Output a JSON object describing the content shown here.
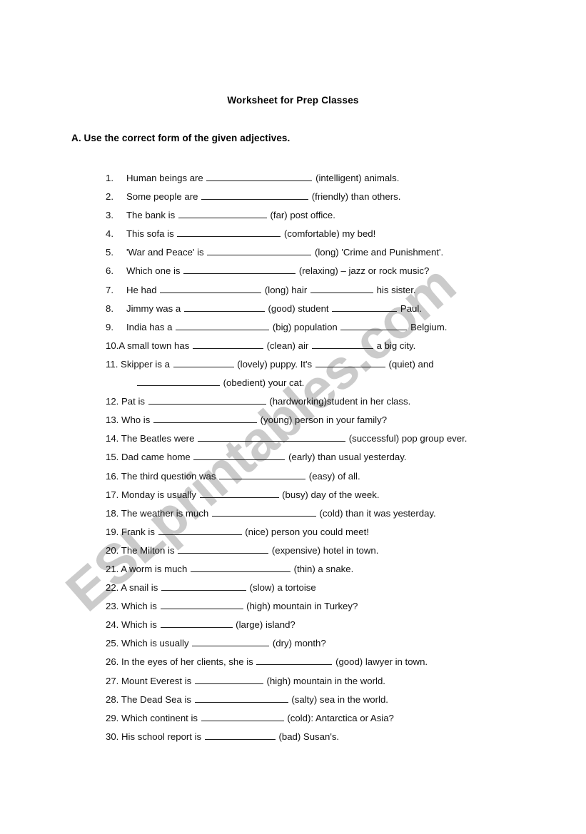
{
  "document": {
    "title": "Worksheet for Prep Classes",
    "watermark": "ESLprintables.com",
    "watermark_color": "#c9c9c9",
    "page_background": "#ffffff",
    "text_color": "#000000"
  },
  "sections": [
    {
      "heading": "A. Use the correct form of the given adjectives.",
      "items": [
        {
          "number": "1.",
          "style": "tab",
          "before": "Human beings are",
          "blank_width": 148,
          "after": "(intelligent) animals."
        },
        {
          "number": "2.",
          "style": "tab",
          "before": "Some people are",
          "blank_width": 150,
          "after": "(friendly) than others."
        },
        {
          "number": "3.",
          "style": "tab",
          "before": "The bank is",
          "blank_width": 124,
          "after": "(far) post office."
        },
        {
          "number": "4.",
          "style": "tab",
          "before": "This sofa is",
          "blank_width": 145,
          "after": "(comfortable) my bed!"
        },
        {
          "number": "5.",
          "style": "tab",
          "before": "'War and Peace' is",
          "blank_width": 146,
          "after": "(long) 'Crime and Punishment'."
        },
        {
          "number": "6.",
          "style": "tab",
          "before": "Which one is",
          "blank_width": 157,
          "after": "(relaxing) – jazz or rock music?"
        },
        {
          "number": "7.",
          "style": "tab",
          "before": "He had",
          "blank_width": 142,
          "after": "(long) hair",
          "blank2_width": 88,
          "after2": "his sister."
        },
        {
          "number": "8.",
          "style": "tab",
          "before": "Jimmy was a",
          "blank_width": 113,
          "after": "(good) student",
          "blank2_width": 91,
          "after2": "Paul."
        },
        {
          "number": "9.",
          "style": "tab",
          "before": "India has a",
          "blank_width": 131,
          "after": "(big) population",
          "blank2_width": 93,
          "after2": "Belgium."
        },
        {
          "number": "10.",
          "style": "tight",
          "before": "A small town has",
          "blank_width": 99,
          "after": "(clean) air",
          "blank2_width": 86,
          "after2": "a big city."
        },
        {
          "number": "11.",
          "style": "inline",
          "before": "Skipper is a",
          "blank_width": 85,
          "after": "(lovely) puppy. It's",
          "blank2_width": 98,
          "after2": "(quiet) and",
          "continuation": {
            "blank_width": 116,
            "after": "(obedient) your cat."
          }
        },
        {
          "number": "12.",
          "style": "inline",
          "before": "Pat is",
          "blank_width": 165,
          "after": "(hardworking)student in her class."
        },
        {
          "number": "13.",
          "style": "inline",
          "before": "Who is",
          "blank_width": 145,
          "after": "(young) person in your family?"
        },
        {
          "number": "14.",
          "style": "inline",
          "before": "The Beatles were",
          "blank_width": 207,
          "after": "(successful) pop group ever."
        },
        {
          "number": "15.",
          "style": "inline",
          "before": "Dad came home",
          "blank_width": 128,
          "after": "(early) than usual yesterday."
        },
        {
          "number": "16.",
          "style": "inline",
          "before": "The third question was",
          "blank_width": 121,
          "after": "(easy) of all."
        },
        {
          "number": "17.",
          "style": "inline",
          "before": "Monday is usually",
          "blank_width": 111,
          "after": "(busy) day of the week."
        },
        {
          "number": "18.",
          "style": "inline",
          "before": "The weather is much",
          "blank_width": 146,
          "after": "(cold) than it was yesterday."
        },
        {
          "number": "19.",
          "style": "inline",
          "before": "Frank is",
          "blank_width": 117,
          "after": "(nice) person you could meet!"
        },
        {
          "number": "20.",
          "style": "inline",
          "before": "The Milton is",
          "blank_width": 127,
          "after": "(expensive) hotel in town."
        },
        {
          "number": "21.",
          "style": "inline",
          "before": "A worm is much",
          "blank_width": 140,
          "after": "(thin) a snake."
        },
        {
          "number": "22.",
          "style": "inline",
          "before": "A snail is",
          "blank_width": 119,
          "after": "(slow) a tortoise"
        },
        {
          "number": "23.",
          "style": "inline",
          "before": "Which is",
          "blank_width": 116,
          "after": "(high) mountain in Turkey?"
        },
        {
          "number": "24.",
          "style": "inline",
          "before": "Which is",
          "blank_width": 101,
          "after": "(large) island?"
        },
        {
          "number": "25.",
          "style": "inline",
          "before": "Which is usually",
          "blank_width": 108,
          "after": "(dry) month?"
        },
        {
          "number": "26.",
          "style": "inline",
          "before": "In the eyes of her clients, she is",
          "blank_width": 106,
          "after": "(good) lawyer in town."
        },
        {
          "number": "27.",
          "style": "inline",
          "before": "Mount Everest is",
          "blank_width": 96,
          "after": "(high) mountain in the world."
        },
        {
          "number": "28.",
          "style": "inline",
          "before": "The Dead Sea is",
          "blank_width": 131,
          "after": "(salty) sea in the world."
        },
        {
          "number": "29.",
          "style": "inline",
          "before": "Which continent is",
          "blank_width": 116,
          "after": "(cold): Antarctica or Asia?"
        },
        {
          "number": "30.",
          "style": "inline",
          "before": "His school report is",
          "blank_width": 99,
          "after": "(bad) Susan's."
        }
      ]
    }
  ]
}
